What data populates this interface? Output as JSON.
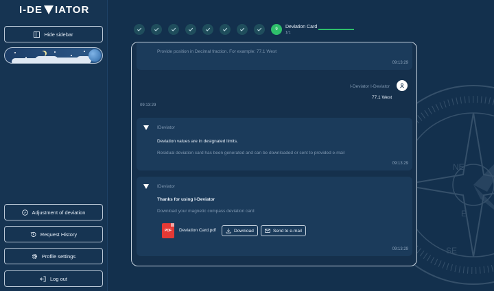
{
  "app": {
    "logo_left": "I-DE",
    "logo_right": "IATOR"
  },
  "sidebar": {
    "hide_label": "Hide sidebar",
    "menu": [
      {
        "label": "Adjustment of deviation"
      },
      {
        "label": "Request History"
      },
      {
        "label": "Profile settings"
      },
      {
        "label": "Log out"
      }
    ]
  },
  "stepper": {
    "completed_steps": 8,
    "active_number": "9",
    "active_title": "Deviation Card",
    "active_sub": "1/1"
  },
  "chat": {
    "msg1": {
      "text": "Provide position in Decimal fraction. For example: 77.1 West",
      "time": "09:13:29"
    },
    "user_msg": {
      "name": "I-Deviator I-Deviator",
      "text": "77.1 West",
      "time": "09:13:29"
    },
    "msg2": {
      "sender": "IDeviator",
      "line1": "Deviation values are in designated limits.",
      "line2": "Residual deviation card has been generated and can be downloaded or sent to provided e-mail",
      "time": "09:13:29"
    },
    "msg3": {
      "sender": "IDeviator",
      "line1": "Thanks for using I-Deviator",
      "line2": "Download your magnetic compass deviation card",
      "file_label": "PDF",
      "file_name": "Deviation Card.pdf",
      "download_label": "Download",
      "email_label": "Send to e-mail",
      "time": "09:13:29"
    }
  },
  "compass": {
    "labels": [
      "NE",
      "E",
      "SE"
    ]
  }
}
